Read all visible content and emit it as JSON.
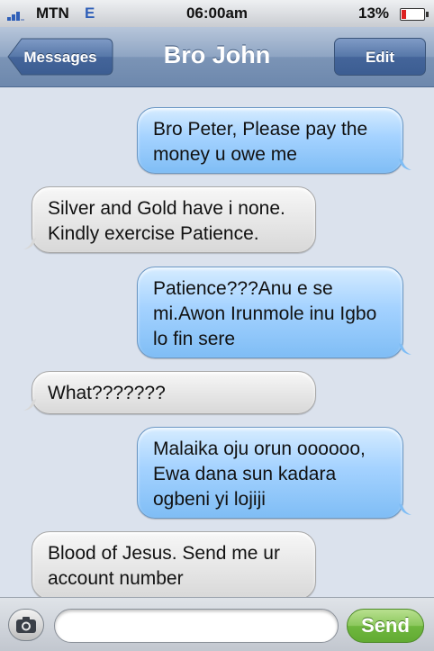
{
  "status_bar": {
    "carrier": "MTN",
    "network": "E",
    "time": "06:00am",
    "battery": "13%",
    "battery_level": 0.13
  },
  "nav": {
    "back_label": "Messages",
    "title": "Bro John",
    "edit_label": "Edit"
  },
  "messages": [
    {
      "from": "me",
      "text": "Bro Peter, Please pay the money u owe me"
    },
    {
      "from": "them",
      "text": "Silver and Gold have i none. Kindly exercise Patience."
    },
    {
      "from": "me",
      "text": "Patience???Anu e se mi.Awon Irunmole inu Igbo lo fin sere"
    },
    {
      "from": "them",
      "text": "What???????"
    },
    {
      "from": "me",
      "text": "Malaika oju orun oooooo, Ewa dana sun kadara ogbeni yi lojiji"
    },
    {
      "from": "them",
      "text": "Blood of Jesus. Send me ur account number"
    }
  ],
  "input_bar": {
    "camera_icon": "camera-icon",
    "text_value": "",
    "send_label": "Send"
  },
  "colors": {
    "sent_bubble": "#8fc6f8",
    "received_bubble": "#e6e6e6",
    "send_button": "#7dbf4c",
    "nav_bar": "#7b94b6"
  }
}
